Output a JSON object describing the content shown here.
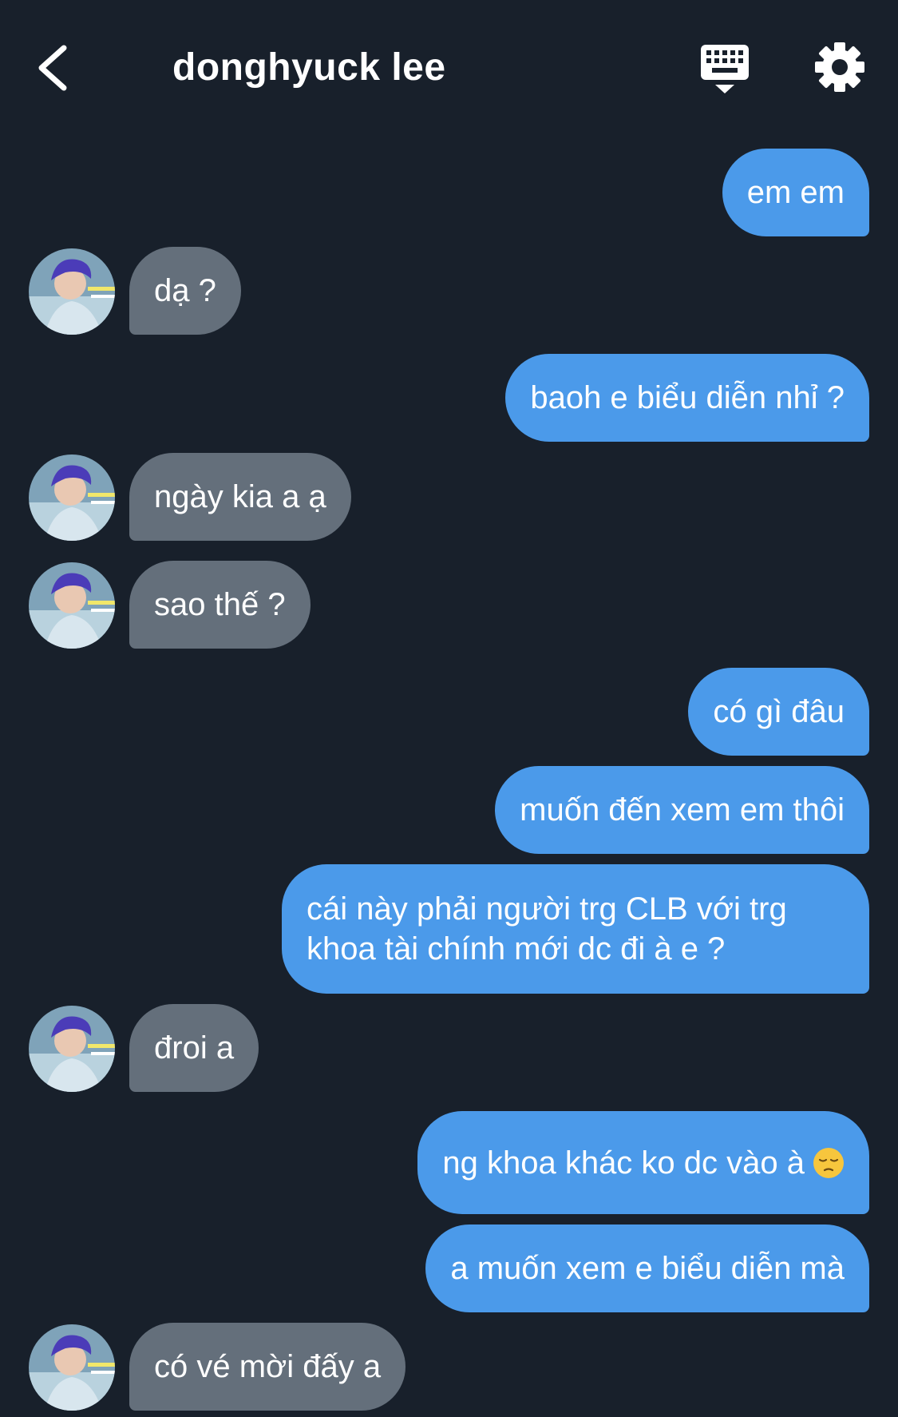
{
  "header": {
    "title": "donghyuck lee",
    "back_icon": "chevron-left-icon",
    "keyboard_icon": "keyboard-icon",
    "settings_icon": "gear-icon"
  },
  "colors": {
    "background": "#18202b",
    "sent_bubble": "#4b9aea",
    "received_bubble": "#646f7b",
    "text": "#ffffff"
  },
  "messages": [
    {
      "from": "me",
      "text": "em em"
    },
    {
      "from": "them",
      "text": "dạ ?"
    },
    {
      "from": "me",
      "text": "baoh e biểu diễn nhỉ ?"
    },
    {
      "from": "them",
      "text": "ngày kia a ạ"
    },
    {
      "from": "them",
      "text": "sao thế ?"
    },
    {
      "from": "me",
      "text": "có gì đâu"
    },
    {
      "from": "me",
      "text": "muốn đến xem em thôi"
    },
    {
      "from": "me",
      "text": "cái này phải người trg CLB với trg khoa tài chính mới dc đi à e ?"
    },
    {
      "from": "them",
      "text": "đroi a"
    },
    {
      "from": "me",
      "text": "ng khoa khác ko dc vào à",
      "emoji": "pensive-face-emoji"
    },
    {
      "from": "me",
      "text": "a muốn xem e biểu diễn mà"
    },
    {
      "from": "them",
      "text": "có vé mời đấy a"
    }
  ]
}
